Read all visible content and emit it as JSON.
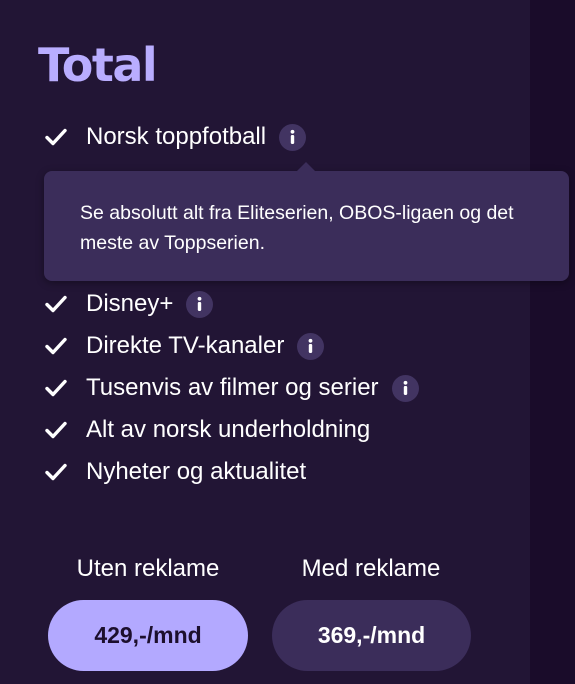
{
  "package": {
    "title": "Total"
  },
  "features": [
    {
      "label": "Norsk toppfotball",
      "has_info": true
    },
    {
      "label": "Disney+",
      "has_info": true
    },
    {
      "label": "Direkte TV-kanaler",
      "has_info": true
    },
    {
      "label": "Tusenvis av filmer og serier",
      "has_info": true
    },
    {
      "label": "Alt av norsk underholdning",
      "has_info": false
    },
    {
      "label": "Nyheter og aktualitet",
      "has_info": false
    }
  ],
  "tooltip": {
    "text": "Se absolutt alt fra Eliteserien, OBOS-ligaen og det meste av Toppserien."
  },
  "pricing": {
    "without_ads": {
      "label": "Uten reklame",
      "price": "429,-/mnd"
    },
    "with_ads": {
      "label": "Med reklame",
      "price": "369,-/mnd"
    }
  },
  "icons": {
    "check": "check-icon",
    "info": "info-icon"
  },
  "colors": {
    "background": "#180b26",
    "card": "#221535",
    "title_accent": "#b9adff",
    "info_button": "#423462",
    "tooltip": "#3b2d5a",
    "primary_button": "#b3a9ff",
    "secondary_button": "#3b2d5a"
  }
}
